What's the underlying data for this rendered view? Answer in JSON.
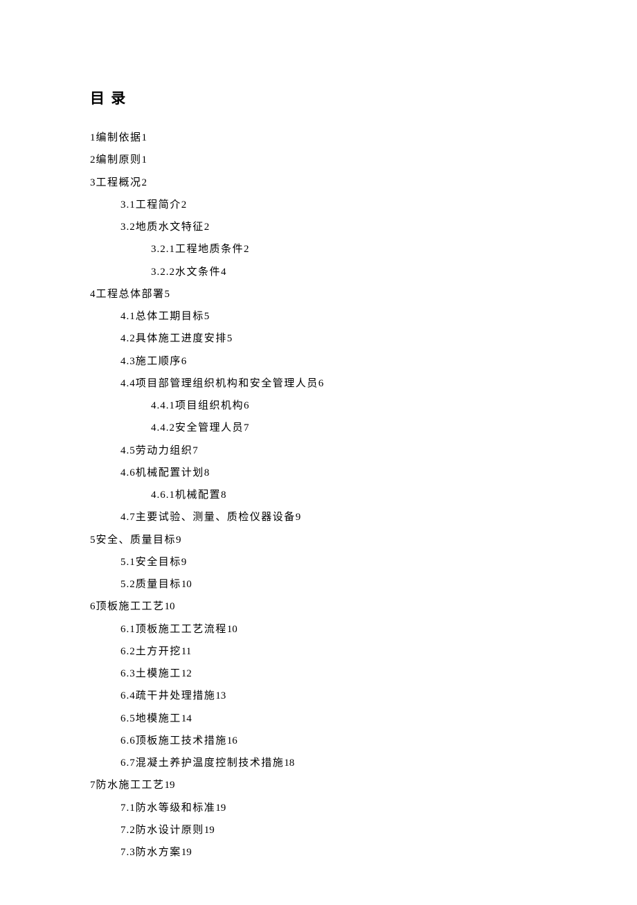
{
  "title": "目 录",
  "entries": [
    {
      "level": 0,
      "num": "1",
      "label": "编制依据",
      "page": "1"
    },
    {
      "level": 0,
      "num": "2",
      "label": "编制原则",
      "page": "1"
    },
    {
      "level": 0,
      "num": "3",
      "label": "工程概况",
      "page": "2"
    },
    {
      "level": 1,
      "num": "3.1",
      "label": "工程简介",
      "page": "2"
    },
    {
      "level": 1,
      "num": "3.2",
      "label": "地质水文特征",
      "page": "2"
    },
    {
      "level": 2,
      "num": "3.2.1",
      "label": "工程地质条件",
      "page": "2"
    },
    {
      "level": 2,
      "num": "3.2.2",
      "label": "水文条件",
      "page": "4"
    },
    {
      "level": 0,
      "num": "4",
      "label": "工程总体部署",
      "page": "5"
    },
    {
      "level": 1,
      "num": "4.1",
      "label": "总体工期目标",
      "page": "5"
    },
    {
      "level": 1,
      "num": "4.2",
      "label": "具体施工进度安排",
      "page": "5"
    },
    {
      "level": 1,
      "num": "4.3",
      "label": "施工顺序",
      "page": "6"
    },
    {
      "level": 1,
      "num": "4.4",
      "label": "项目部管理组织机构和安全管理人员",
      "page": "6"
    },
    {
      "level": 2,
      "num": "4.4.1",
      "label": "项目组织机构",
      "page": "6"
    },
    {
      "level": 2,
      "num": "4.4.2",
      "label": "安全管理人员",
      "page": "7"
    },
    {
      "level": 1,
      "num": "4.5",
      "label": "劳动力组织",
      "page": "7"
    },
    {
      "level": 1,
      "num": "4.6",
      "label": "机械配置计划",
      "page": "8"
    },
    {
      "level": 2,
      "num": "4.6.1",
      "label": "机械配置",
      "page": "8"
    },
    {
      "level": 1,
      "num": "4.7",
      "label": "主要试验、测量、质检仪器设备",
      "page": "9"
    },
    {
      "level": 0,
      "num": "5",
      "label": "安全、质量目标",
      "page": "9"
    },
    {
      "level": 1,
      "num": "5.1",
      "label": "安全目标",
      "page": "9"
    },
    {
      "level": 1,
      "num": "5.2",
      "label": "质量目标",
      "page": "10"
    },
    {
      "level": 0,
      "num": "6",
      "label": "顶板施工工艺",
      "page": "10"
    },
    {
      "level": 1,
      "num": "6.1",
      "label": "顶板施工工艺流程",
      "page": "10"
    },
    {
      "level": 1,
      "num": "6.2",
      "label": "土方开挖",
      "page": "11"
    },
    {
      "level": 1,
      "num": "6.3",
      "label": "土模施工",
      "page": "12"
    },
    {
      "level": 1,
      "num": "6.4",
      "label": "疏干井处理措施",
      "page": "13"
    },
    {
      "level": 1,
      "num": "6.5",
      "label": "地模施工",
      "page": "14"
    },
    {
      "level": 1,
      "num": "6.6",
      "label": "顶板施工技术措施",
      "page": "16"
    },
    {
      "level": 1,
      "num": "6.7",
      "label": "混凝土养护温度控制技术措施",
      "page": "18"
    },
    {
      "level": 0,
      "num": "7",
      "label": "防水施工工艺",
      "page": "19"
    },
    {
      "level": 1,
      "num": "7.1",
      "label": "防水等级和标准",
      "page": "19"
    },
    {
      "level": 1,
      "num": "7.2",
      "label": "防水设计原则",
      "page": "19"
    },
    {
      "level": 1,
      "num": "7.3",
      "label": "防水方案",
      "page": "19"
    }
  ]
}
